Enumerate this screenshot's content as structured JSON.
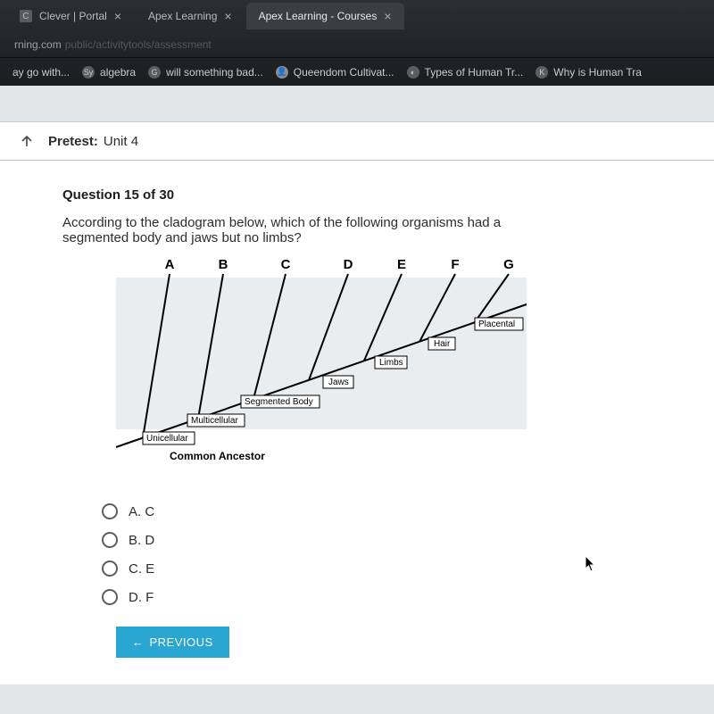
{
  "browser": {
    "tabs": [
      {
        "favicon": "C",
        "label": "Clever | Portal"
      },
      {
        "favicon": "",
        "label": "Apex Learning"
      },
      {
        "favicon": "",
        "label": "Apex Learning - Courses"
      }
    ],
    "url": "rning.com",
    "urlRest": "public/activitytools/assessment",
    "bookmarks": [
      {
        "ico": "",
        "label": "ay go with..."
      },
      {
        "ico": "Sy",
        "label": "algebra"
      },
      {
        "ico": "G",
        "label": "will something bad..."
      },
      {
        "ico": "",
        "label": "Queendom Cultivat..."
      },
      {
        "ico": "",
        "label": "Types of Human Tr..."
      },
      {
        "ico": "K",
        "label": "Why is Human Tra"
      }
    ]
  },
  "page": {
    "headerPrefix": "Pretest:",
    "headerUnit": "Unit 4"
  },
  "question": {
    "title": "Question 15 of 30",
    "text": "According to the cladogram below, which of the following organisms had a segmented body and jaws but no limbs?",
    "answers": [
      {
        "label": "A. C"
      },
      {
        "label": "B. D"
      },
      {
        "label": "C. E"
      },
      {
        "label": "D. F"
      }
    ],
    "previous": "PREVIOUS"
  },
  "chart_data": {
    "type": "cladogram",
    "tips": [
      "A",
      "B",
      "C",
      "D",
      "E",
      "F",
      "G"
    ],
    "traits": [
      {
        "name": "Unicellular",
        "after_tip_index": 0
      },
      {
        "name": "Multicellular",
        "after_tip_index": 1
      },
      {
        "name": "Segmented Body",
        "after_tip_index": 2
      },
      {
        "name": "Jaws",
        "after_tip_index": 3
      },
      {
        "name": "Limbs",
        "after_tip_index": 4
      },
      {
        "name": "Hair",
        "after_tip_index": 5
      },
      {
        "name": "Placental",
        "after_tip_index": 6
      }
    ],
    "root_label": "Common Ancestor"
  }
}
